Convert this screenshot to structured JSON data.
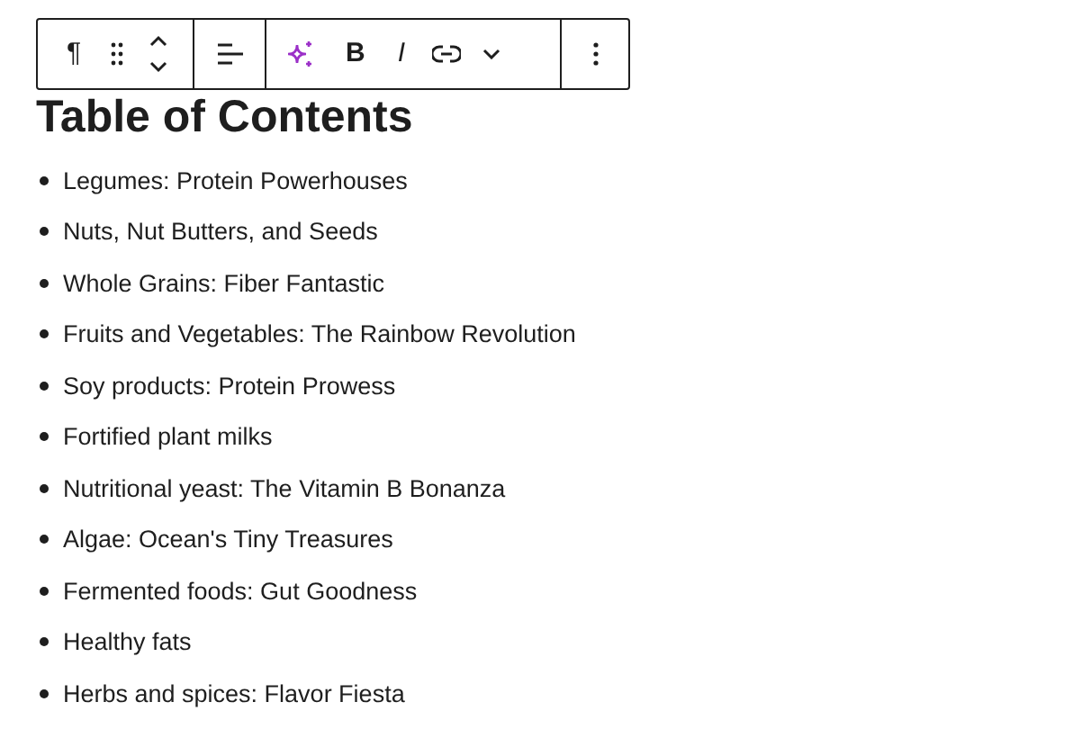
{
  "toolbar": {
    "paragraph_glyph": "¶",
    "bold_glyph": "B",
    "italic_glyph": "I"
  },
  "heading": "Table of Contents",
  "items": [
    "Legumes: Protein Powerhouses",
    "Nuts, Nut Butters, and Seeds",
    "Whole Grains: Fiber Fantastic",
    "Fruits and Vegetables: The Rainbow Revolution",
    "Soy products: Protein Prowess",
    "Fortified plant milks",
    "Nutritional yeast: The Vitamin B Bonanza",
    "Algae: Ocean's Tiny Treasures",
    "Fermented foods: Gut Goodness",
    "Healthy fats",
    "Herbs and spices: Flavor Fiesta"
  ]
}
